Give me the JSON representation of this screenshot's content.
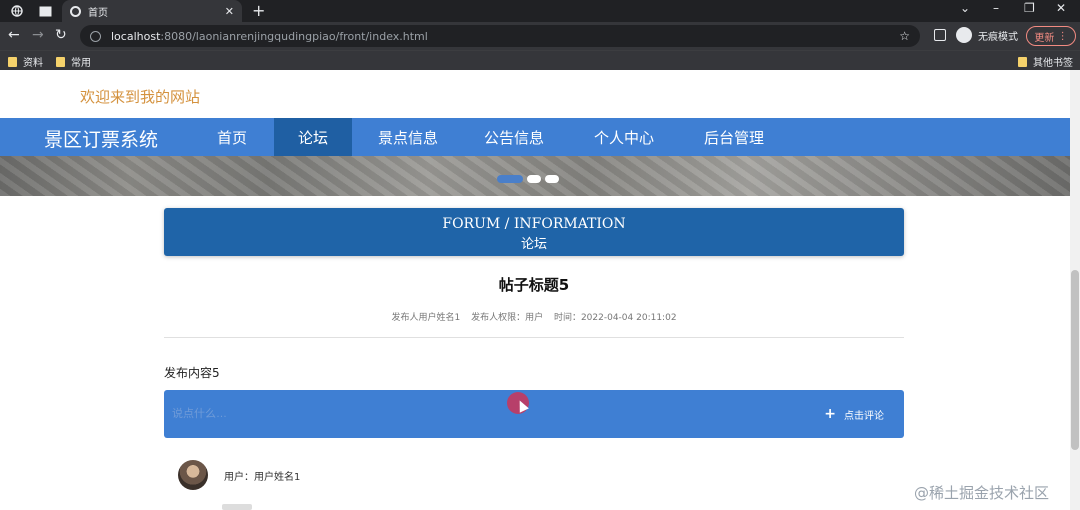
{
  "browser": {
    "tab_title": "首页",
    "url_host": "localhost",
    "url_rest": ":8080/laonianrenjingqudingpiao/front/index.html",
    "incognito_label": "无痕模式",
    "update_label": "更新",
    "bookmarks": [
      "资料",
      "常用"
    ],
    "other_bookmarks": "其他书签"
  },
  "site": {
    "welcome": "欢迎来到我的网站",
    "brand": "景区订票系统",
    "nav": [
      {
        "label": "首页",
        "active": false
      },
      {
        "label": "论坛",
        "active": true
      },
      {
        "label": "景点信息",
        "active": false
      },
      {
        "label": "公告信息",
        "active": false
      },
      {
        "label": "个人中心",
        "active": false
      },
      {
        "label": "后台管理",
        "active": false
      }
    ]
  },
  "banner": {
    "active_dot": 0,
    "dot_count": 3
  },
  "section": {
    "title_en": "FORUM / INFORMATION",
    "title_cn": "论坛"
  },
  "post": {
    "title": "帖子标题5",
    "author": "发布人用户姓名1",
    "author_type": "发布人权限：用户",
    "time": "时间：2022-04-04 20:11:02",
    "content": "发布内容5"
  },
  "comment": {
    "placeholder": "说点什么…",
    "button_label": "点击评论"
  },
  "comments": [
    {
      "user": "用户：用户姓名1"
    }
  ],
  "watermark": "@稀土掘金技术社区",
  "colors": {
    "nav": "#3f7fd3",
    "nav_active": "#1f5fa3",
    "section": "#1f64a8",
    "welcome": "#d4923e"
  }
}
